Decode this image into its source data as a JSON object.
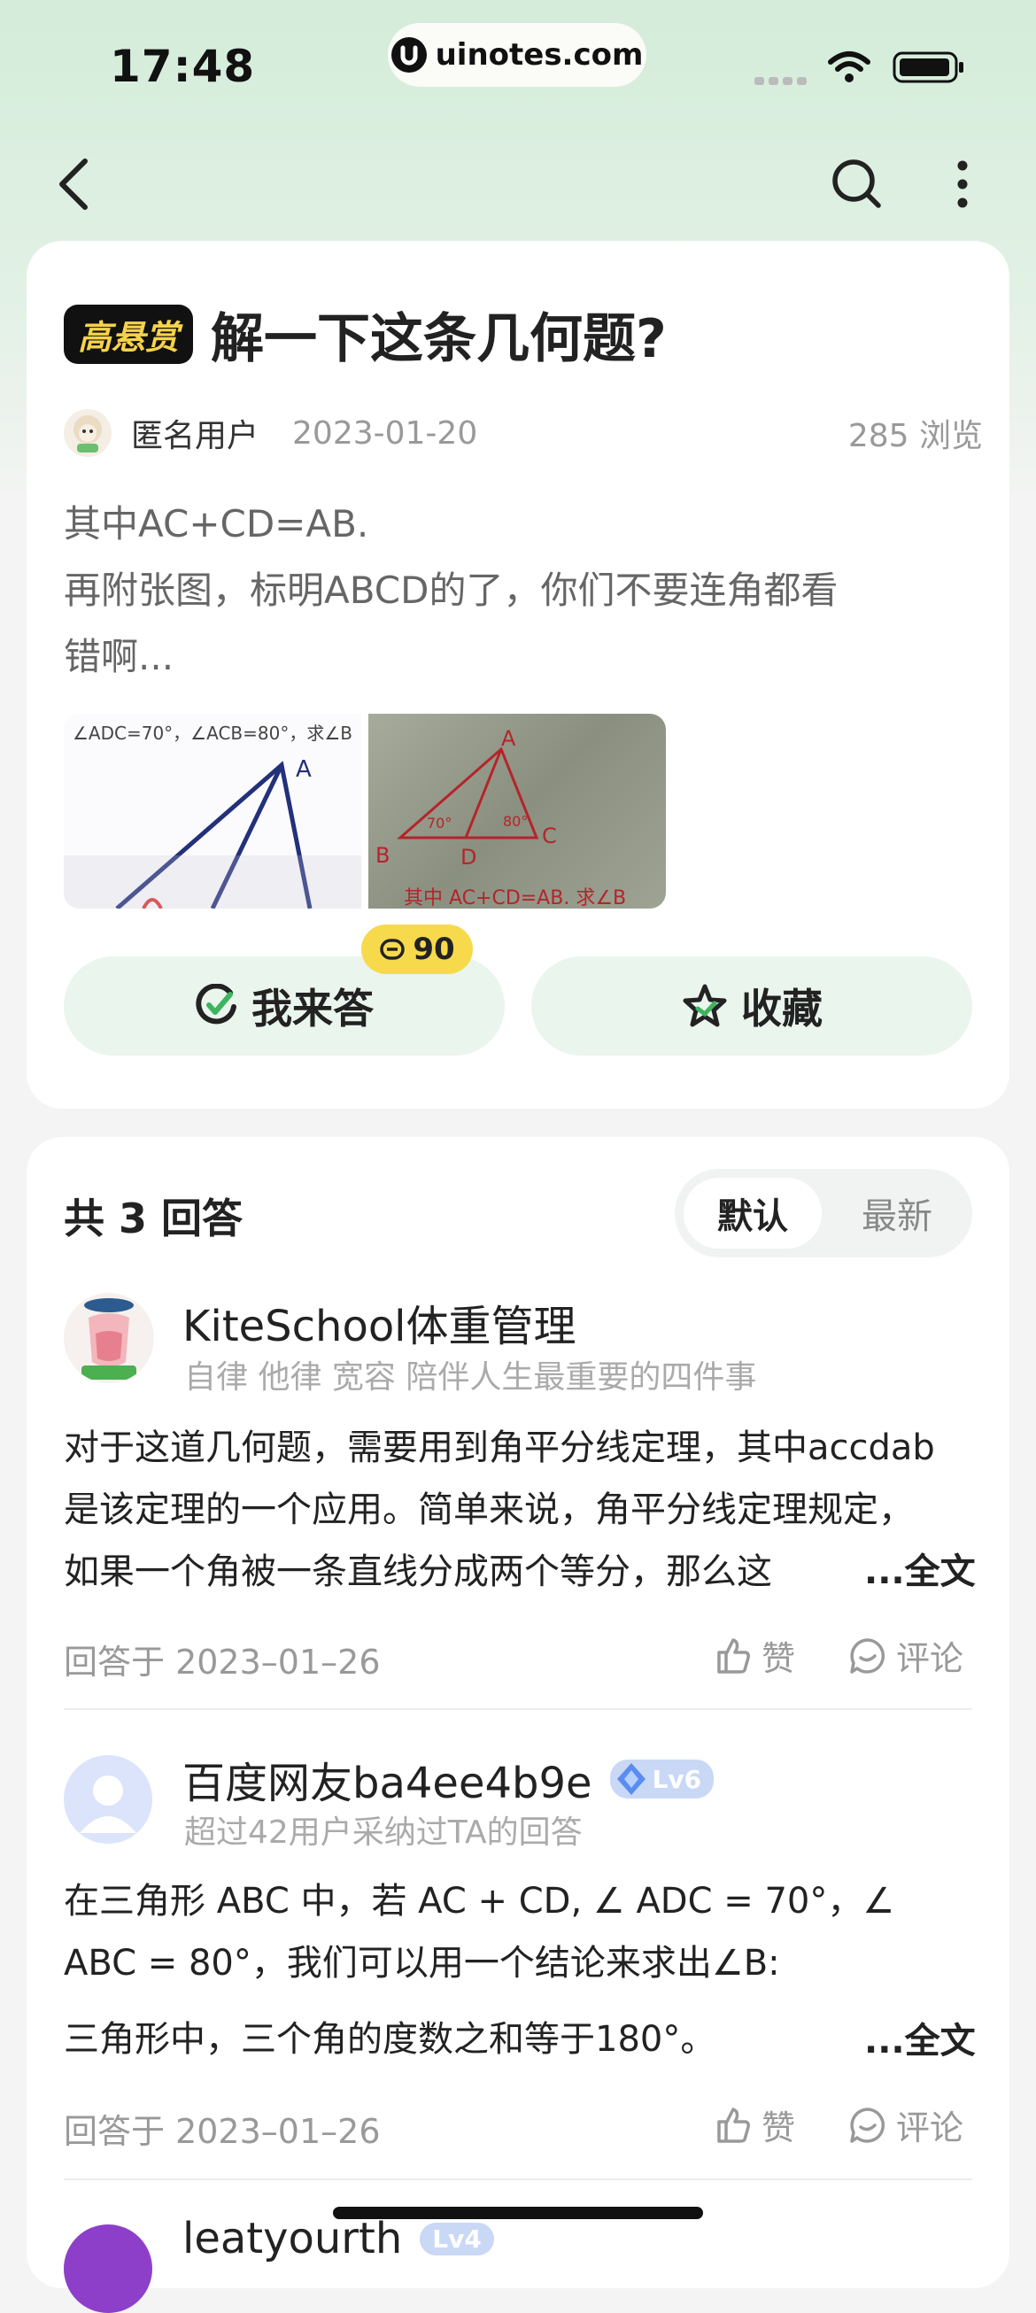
{
  "status_bar": {
    "time": "17:48",
    "url": "uinotes.com"
  },
  "nav": {
    "back_icon": "chevron-left-icon",
    "search_icon": "search-icon",
    "more_icon": "more-vertical-icon"
  },
  "question": {
    "tag": "高悬赏",
    "title": "解一下这条几何题?",
    "author": "匿名用户",
    "date": "2023-01-20",
    "views": "285 浏览",
    "body_line1": "其中AC+CD=AB.",
    "body_line2": "再附张图，标明ABCD的了，你们不要连角都看",
    "body_line3": "错啊...",
    "image1_caption": "∠ADC=70°，∠ACB=80°，求∠B",
    "image1_label": "A",
    "image2_caption": "其中 AC+CD=AB. 求∠B",
    "image2_labels": [
      "A",
      "B",
      "C",
      "D",
      "70°",
      "80°"
    ],
    "reward": "90",
    "answer_button": "我来答",
    "collect_button": "收藏"
  },
  "answers_section": {
    "count_label": "共 3 回答",
    "sort_default": "默认",
    "sort_latest": "最新"
  },
  "answers": [
    {
      "name": "KiteSchool体重管理",
      "subtitle": "自律 他律 宽容 陪伴人生最重要的四件事",
      "line1": "对于这道几何题，需要用到角平分线定理，其中accdab",
      "line2": "是该定理的一个应用。简单来说，角平分线定理规定，",
      "line3": "如果一个角被一条直线分成两个等分，那么这",
      "full_text": "...全文",
      "answered_at": "回答于 2023–01–26",
      "like": "赞",
      "comment": "评论"
    },
    {
      "name": "百度网友ba4ee4b9e",
      "level": "Lv6",
      "subtitle": "超过42用户采纳过TA的回答",
      "line1": "在三角形 ABC 中，若 AC + CD, ∠ ADC = 70°，∠",
      "line2": "ABC = 80°，我们可以用一个结论来求出∠B:",
      "line3": "三角形中，三个角的度数之和等于180°。",
      "full_text": "...全文",
      "answered_at": "回答于 2023–01–26",
      "like": "赞",
      "comment": "评论"
    },
    {
      "name": "leatyourth",
      "level": "Lv4"
    }
  ],
  "colors": {
    "accent_green": "#eaf5ee",
    "reward_yellow": "#f7d94c",
    "tag_text": "#f7d34a"
  }
}
